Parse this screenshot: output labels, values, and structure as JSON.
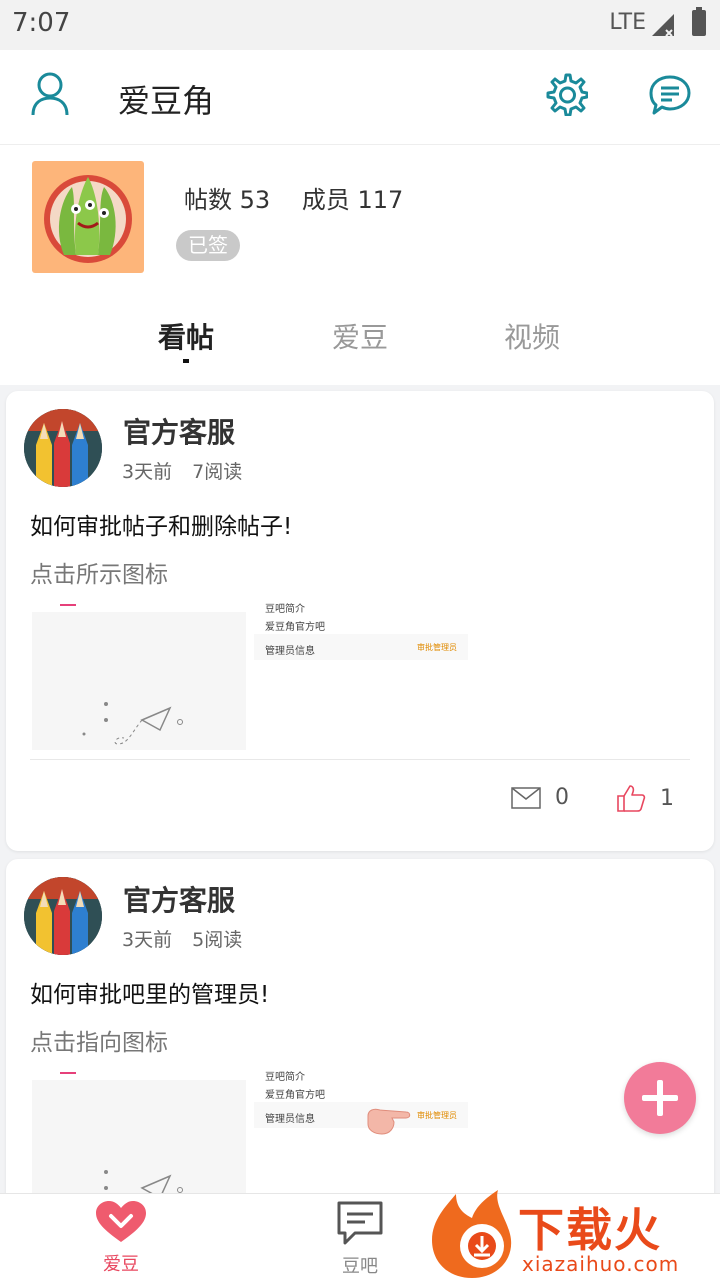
{
  "status_bar": {
    "time": "7:07",
    "network": "LTE"
  },
  "header": {
    "title": "爱豆角"
  },
  "group": {
    "posts_label": "帖数",
    "posts_count": "53",
    "members_label": "成员",
    "members_count": "117",
    "signed_badge": "已签"
  },
  "tabs": [
    {
      "label": "看帖",
      "active": true
    },
    {
      "label": "爱豆",
      "active": false
    },
    {
      "label": "视频",
      "active": false
    }
  ],
  "posts": [
    {
      "author": "官方客服",
      "time": "3天前",
      "reads": "7阅读",
      "title": "如何审批帖子和删除帖子!",
      "desc": "点击所示图标",
      "thumb": {
        "r1": "豆吧简介",
        "r2": "爱豆角官方吧",
        "r3": "管理员信息",
        "r3_action": "审批管理员"
      },
      "comments": "0",
      "likes": "1"
    },
    {
      "author": "官方客服",
      "time": "3天前",
      "reads": "5阅读",
      "title": "如何审批吧里的管理员!",
      "desc": "点击指向图标",
      "thumb": {
        "r1": "豆吧简介",
        "r2": "爱豆角官方吧",
        "r3": "管理员信息",
        "r3_action": "审批管理员"
      }
    }
  ],
  "bottom_nav": [
    {
      "label": "爱豆",
      "active": true
    },
    {
      "label": "豆吧",
      "active": false
    }
  ],
  "watermark": {
    "text": "下载火",
    "sub": "xiazaihuo.com"
  },
  "colors": {
    "accent_teal": "#1a8a9a",
    "pink": "#e8475f",
    "fab": "#f27b99"
  }
}
